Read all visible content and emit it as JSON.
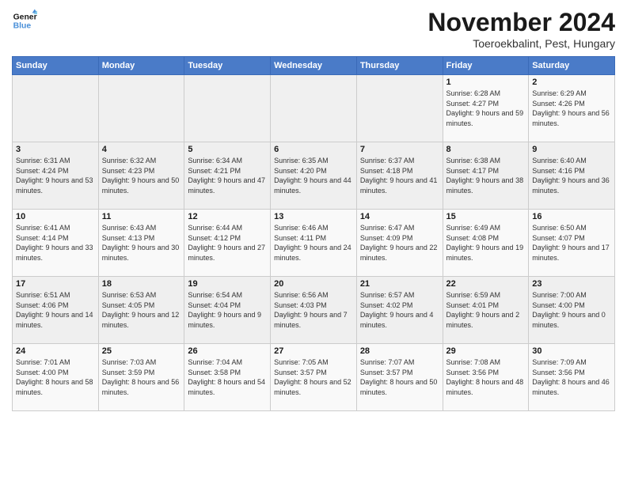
{
  "logo": {
    "line1": "General",
    "line2": "Blue"
  },
  "title": "November 2024",
  "location": "Toeroekbalint, Pest, Hungary",
  "days_header": [
    "Sunday",
    "Monday",
    "Tuesday",
    "Wednesday",
    "Thursday",
    "Friday",
    "Saturday"
  ],
  "weeks": [
    [
      {
        "day": "",
        "info": ""
      },
      {
        "day": "",
        "info": ""
      },
      {
        "day": "",
        "info": ""
      },
      {
        "day": "",
        "info": ""
      },
      {
        "day": "",
        "info": ""
      },
      {
        "day": "1",
        "info": "Sunrise: 6:28 AM\nSunset: 4:27 PM\nDaylight: 9 hours and 59 minutes."
      },
      {
        "day": "2",
        "info": "Sunrise: 6:29 AM\nSunset: 4:26 PM\nDaylight: 9 hours and 56 minutes."
      }
    ],
    [
      {
        "day": "3",
        "info": "Sunrise: 6:31 AM\nSunset: 4:24 PM\nDaylight: 9 hours and 53 minutes."
      },
      {
        "day": "4",
        "info": "Sunrise: 6:32 AM\nSunset: 4:23 PM\nDaylight: 9 hours and 50 minutes."
      },
      {
        "day": "5",
        "info": "Sunrise: 6:34 AM\nSunset: 4:21 PM\nDaylight: 9 hours and 47 minutes."
      },
      {
        "day": "6",
        "info": "Sunrise: 6:35 AM\nSunset: 4:20 PM\nDaylight: 9 hours and 44 minutes."
      },
      {
        "day": "7",
        "info": "Sunrise: 6:37 AM\nSunset: 4:18 PM\nDaylight: 9 hours and 41 minutes."
      },
      {
        "day": "8",
        "info": "Sunrise: 6:38 AM\nSunset: 4:17 PM\nDaylight: 9 hours and 38 minutes."
      },
      {
        "day": "9",
        "info": "Sunrise: 6:40 AM\nSunset: 4:16 PM\nDaylight: 9 hours and 36 minutes."
      }
    ],
    [
      {
        "day": "10",
        "info": "Sunrise: 6:41 AM\nSunset: 4:14 PM\nDaylight: 9 hours and 33 minutes."
      },
      {
        "day": "11",
        "info": "Sunrise: 6:43 AM\nSunset: 4:13 PM\nDaylight: 9 hours and 30 minutes."
      },
      {
        "day": "12",
        "info": "Sunrise: 6:44 AM\nSunset: 4:12 PM\nDaylight: 9 hours and 27 minutes."
      },
      {
        "day": "13",
        "info": "Sunrise: 6:46 AM\nSunset: 4:11 PM\nDaylight: 9 hours and 24 minutes."
      },
      {
        "day": "14",
        "info": "Sunrise: 6:47 AM\nSunset: 4:09 PM\nDaylight: 9 hours and 22 minutes."
      },
      {
        "day": "15",
        "info": "Sunrise: 6:49 AM\nSunset: 4:08 PM\nDaylight: 9 hours and 19 minutes."
      },
      {
        "day": "16",
        "info": "Sunrise: 6:50 AM\nSunset: 4:07 PM\nDaylight: 9 hours and 17 minutes."
      }
    ],
    [
      {
        "day": "17",
        "info": "Sunrise: 6:51 AM\nSunset: 4:06 PM\nDaylight: 9 hours and 14 minutes."
      },
      {
        "day": "18",
        "info": "Sunrise: 6:53 AM\nSunset: 4:05 PM\nDaylight: 9 hours and 12 minutes."
      },
      {
        "day": "19",
        "info": "Sunrise: 6:54 AM\nSunset: 4:04 PM\nDaylight: 9 hours and 9 minutes."
      },
      {
        "day": "20",
        "info": "Sunrise: 6:56 AM\nSunset: 4:03 PM\nDaylight: 9 hours and 7 minutes."
      },
      {
        "day": "21",
        "info": "Sunrise: 6:57 AM\nSunset: 4:02 PM\nDaylight: 9 hours and 4 minutes."
      },
      {
        "day": "22",
        "info": "Sunrise: 6:59 AM\nSunset: 4:01 PM\nDaylight: 9 hours and 2 minutes."
      },
      {
        "day": "23",
        "info": "Sunrise: 7:00 AM\nSunset: 4:00 PM\nDaylight: 9 hours and 0 minutes."
      }
    ],
    [
      {
        "day": "24",
        "info": "Sunrise: 7:01 AM\nSunset: 4:00 PM\nDaylight: 8 hours and 58 minutes."
      },
      {
        "day": "25",
        "info": "Sunrise: 7:03 AM\nSunset: 3:59 PM\nDaylight: 8 hours and 56 minutes."
      },
      {
        "day": "26",
        "info": "Sunrise: 7:04 AM\nSunset: 3:58 PM\nDaylight: 8 hours and 54 minutes."
      },
      {
        "day": "27",
        "info": "Sunrise: 7:05 AM\nSunset: 3:57 PM\nDaylight: 8 hours and 52 minutes."
      },
      {
        "day": "28",
        "info": "Sunrise: 7:07 AM\nSunset: 3:57 PM\nDaylight: 8 hours and 50 minutes."
      },
      {
        "day": "29",
        "info": "Sunrise: 7:08 AM\nSunset: 3:56 PM\nDaylight: 8 hours and 48 minutes."
      },
      {
        "day": "30",
        "info": "Sunrise: 7:09 AM\nSunset: 3:56 PM\nDaylight: 8 hours and 46 minutes."
      }
    ]
  ]
}
